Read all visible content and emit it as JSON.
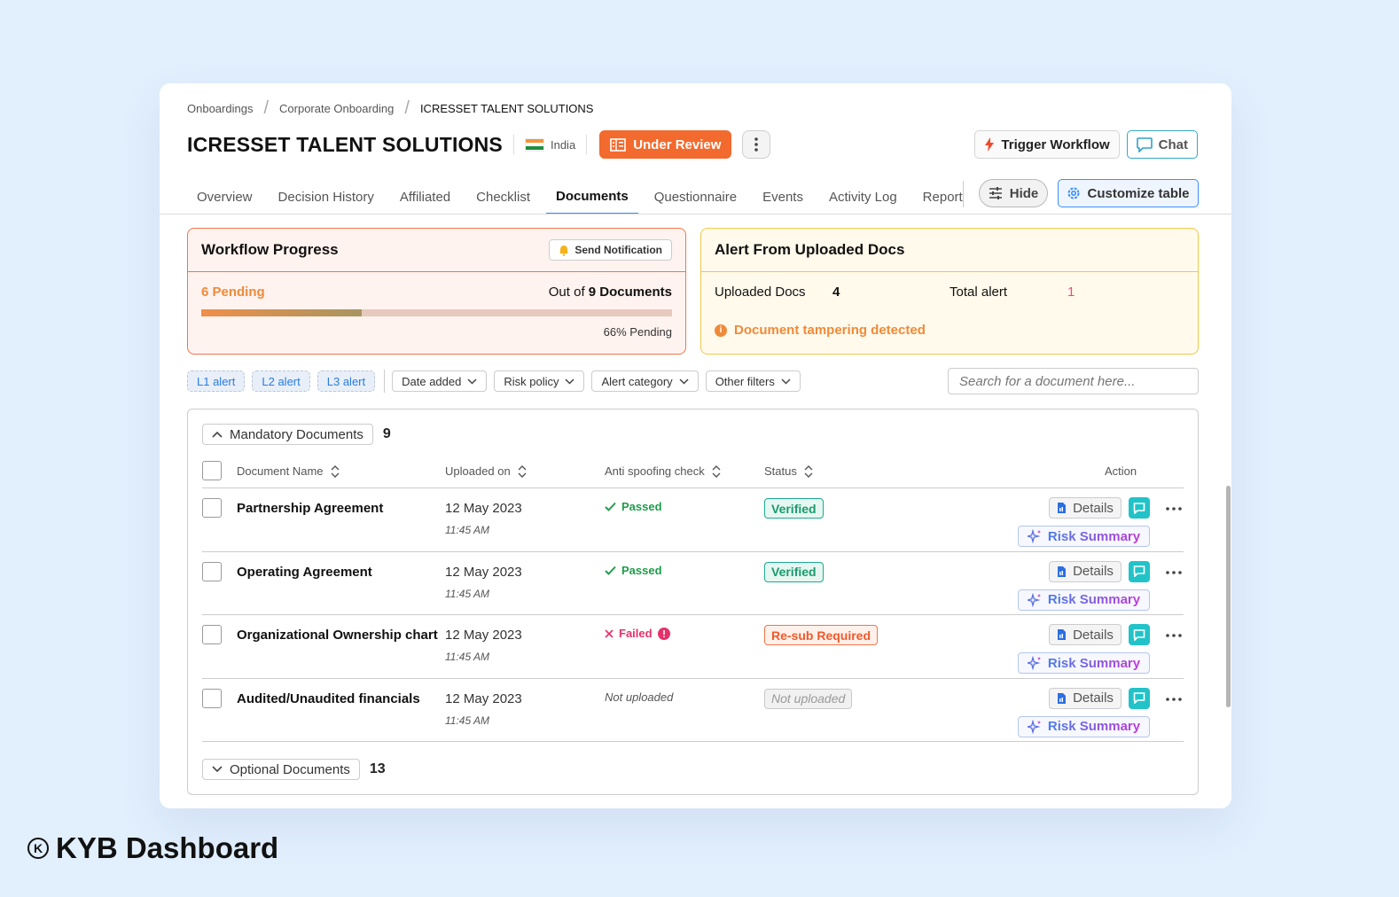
{
  "breadcrumb": [
    "Onboardings",
    "Corporate Onboarding",
    "ICRESSET TALENT SOLUTIONS"
  ],
  "header": {
    "title": "ICRESSET TALENT SOLUTIONS",
    "country": "India",
    "status": "Under Review",
    "trigger_label": "Trigger Workflow",
    "chat_label": "Chat"
  },
  "tabs": [
    "Overview",
    "Decision History",
    "Affiliated",
    "Checklist",
    "Documents",
    "Questionnaire",
    "Events",
    "Activity Log",
    "Report"
  ],
  "active_tab": "Documents",
  "tab_actions": {
    "hide_label": "Hide",
    "customize_label": "Customize table"
  },
  "workflow": {
    "title": "Workflow Progress",
    "notify_label": "Send Notification",
    "pending_text": "6 Pending",
    "out_of_prefix": "Out of",
    "out_of_value": "9 Documents",
    "pending_fraction": 0.66,
    "pending_pct_text": "66% Pending"
  },
  "alerts": {
    "title": "Alert From Uploaded Docs",
    "uploaded_label": "Uploaded Docs",
    "uploaded_value": "4",
    "total_label": "Total alert",
    "total_value": "1",
    "warning": "Document tampering detected"
  },
  "filters": {
    "chips": [
      "L1 alert",
      "L2 alert",
      "L3 alert"
    ],
    "dropdowns": [
      "Date added",
      "Risk policy",
      "Alert category",
      "Other filters"
    ],
    "search_placeholder": "Search for a document here..."
  },
  "mandatory": {
    "label": "Mandatory Documents",
    "count": "9",
    "columns": {
      "name": "Document Name",
      "uploaded": "Uploaded on",
      "spoof": "Anti spoofing check",
      "status": "Status",
      "action": "Action"
    },
    "rows": [
      {
        "name": "Partnership Agreement",
        "date": "12 May 2023",
        "time": "11:45 AM",
        "spoof": "Passed",
        "status": "Verified"
      },
      {
        "name": "Operating Agreement",
        "date": "12 May 2023",
        "time": "11:45 AM",
        "spoof": "Passed",
        "status": "Verified"
      },
      {
        "name": "Organizational Ownership chart",
        "date": "12 May 2023",
        "time": "11:45 AM",
        "spoof": "Failed",
        "status": "Re-sub Required"
      },
      {
        "name": "Audited/Unaudited financials",
        "date": "12 May 2023",
        "time": "11:45 AM",
        "spoof": "Not uploaded",
        "status": "Not uploaded"
      }
    ],
    "details_label": "Details",
    "risk_label": "Risk Summary"
  },
  "optional": {
    "label": "Optional Documents",
    "count": "13"
  },
  "brand": "KYB Dashboard",
  "colors": {
    "accent": "#f26a2e",
    "primary": "#3b8ff6",
    "success": "#1e9d4a",
    "danger": "#e8306a"
  }
}
